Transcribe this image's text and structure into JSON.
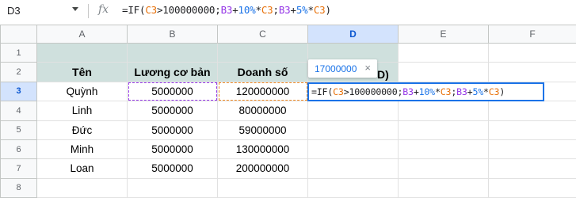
{
  "name_box": "D3",
  "formula_bar": {
    "fx_icon": "fx-icon",
    "parts": [
      "=IF(",
      "C3",
      ">100000000;",
      "B3",
      "+",
      "10%",
      "*",
      "C3",
      ";",
      "B3",
      "+",
      "5%",
      "*",
      "C3",
      ")"
    ]
  },
  "columns": [
    "A",
    "B",
    "C",
    "D",
    "E",
    "F"
  ],
  "rows": [
    "1",
    "2",
    "3",
    "4",
    "5",
    "6",
    "7",
    "8"
  ],
  "headers": {
    "a": "Tên",
    "b": "Lương cơ bản",
    "c": "Doanh số",
    "d_tail": "D)"
  },
  "table_rows": [
    {
      "name": "Quỳnh",
      "base": "5000000",
      "sales": "120000000"
    },
    {
      "name": "Linh",
      "base": "5000000",
      "sales": "80000000"
    },
    {
      "name": "Đức",
      "base": "5000000",
      "sales": "59000000"
    },
    {
      "name": "Minh",
      "base": "5000000",
      "sales": "130000000"
    },
    {
      "name": "Loan",
      "base": "5000000",
      "sales": "200000000"
    }
  ],
  "tooltip": {
    "value": "17000000",
    "close": "×"
  },
  "cell_editor": {
    "parts": [
      "=IF(",
      "C3",
      ">100000000;",
      "B3",
      "+",
      "10%",
      "*",
      "C3",
      ";",
      "B3",
      "+",
      "5%",
      "*",
      "C3",
      ")"
    ]
  },
  "colors": {
    "selection": "#1a73e8",
    "ref_b": "#9334e6",
    "ref_c": "#e8710a",
    "header_fill": "#cfe0dd"
  }
}
